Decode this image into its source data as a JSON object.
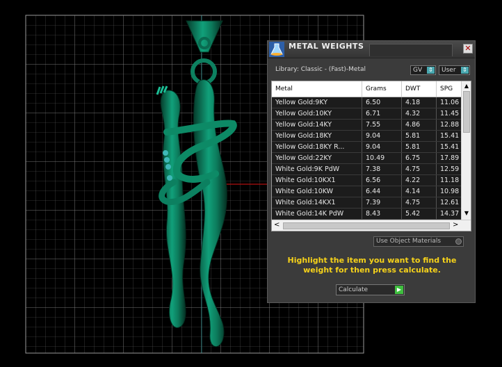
{
  "panel": {
    "title": "METAL WEIGHTS",
    "close_glyph": "✕",
    "library": "Library: Classic - (Fast)-Metal",
    "gv_value": "GV",
    "user_value": "User",
    "combo_arrow": "⇕"
  },
  "table": {
    "columns": [
      "Metal",
      "Grams",
      "DWT",
      "SPG"
    ],
    "rows": [
      {
        "metal": "Yellow Gold:9KY",
        "grams": "6.50",
        "dwt": "4.18",
        "spg": "11.06"
      },
      {
        "metal": "Yellow Gold:10KY",
        "grams": "6.71",
        "dwt": "4.32",
        "spg": "11.45"
      },
      {
        "metal": "Yellow Gold:14KY",
        "grams": "7.55",
        "dwt": "4.86",
        "spg": "12.88"
      },
      {
        "metal": "Yellow Gold:18KY",
        "grams": "9.04",
        "dwt": "5.81",
        "spg": "15.41"
      },
      {
        "metal": "Yellow Gold:18KY R...",
        "grams": "9.04",
        "dwt": "5.81",
        "spg": "15.41"
      },
      {
        "metal": "Yellow Gold:22KY",
        "grams": "10.49",
        "dwt": "6.75",
        "spg": "17.89"
      },
      {
        "metal": "White Gold:9K PdW",
        "grams": "7.38",
        "dwt": "4.75",
        "spg": "12.59"
      },
      {
        "metal": "White Gold:10KX1",
        "grams": "6.56",
        "dwt": "4.22",
        "spg": "11.18"
      },
      {
        "metal": "White Gold:10KW",
        "grams": "6.44",
        "dwt": "4.14",
        "spg": "10.98"
      },
      {
        "metal": "White Gold:14KX1",
        "grams": "7.39",
        "dwt": "4.75",
        "spg": "12.61"
      },
      {
        "metal": "White Gold:14K PdW",
        "grams": "8.43",
        "dwt": "5.42",
        "spg": "14.37"
      }
    ],
    "scroll_up": "▲",
    "scroll_down": "▼",
    "scroll_left": "<",
    "scroll_right": ">"
  },
  "use_object_materials": "Use Object Materials",
  "hint": "Highlight the item you want to find the weight for then press calculate.",
  "calculate_label": "Calculate",
  "calculate_arrow": "▶",
  "colors": {
    "model": "#0f8060",
    "grid": "#7a7a7a",
    "axis_red": "#b01010",
    "hint": "#f6d21a"
  }
}
